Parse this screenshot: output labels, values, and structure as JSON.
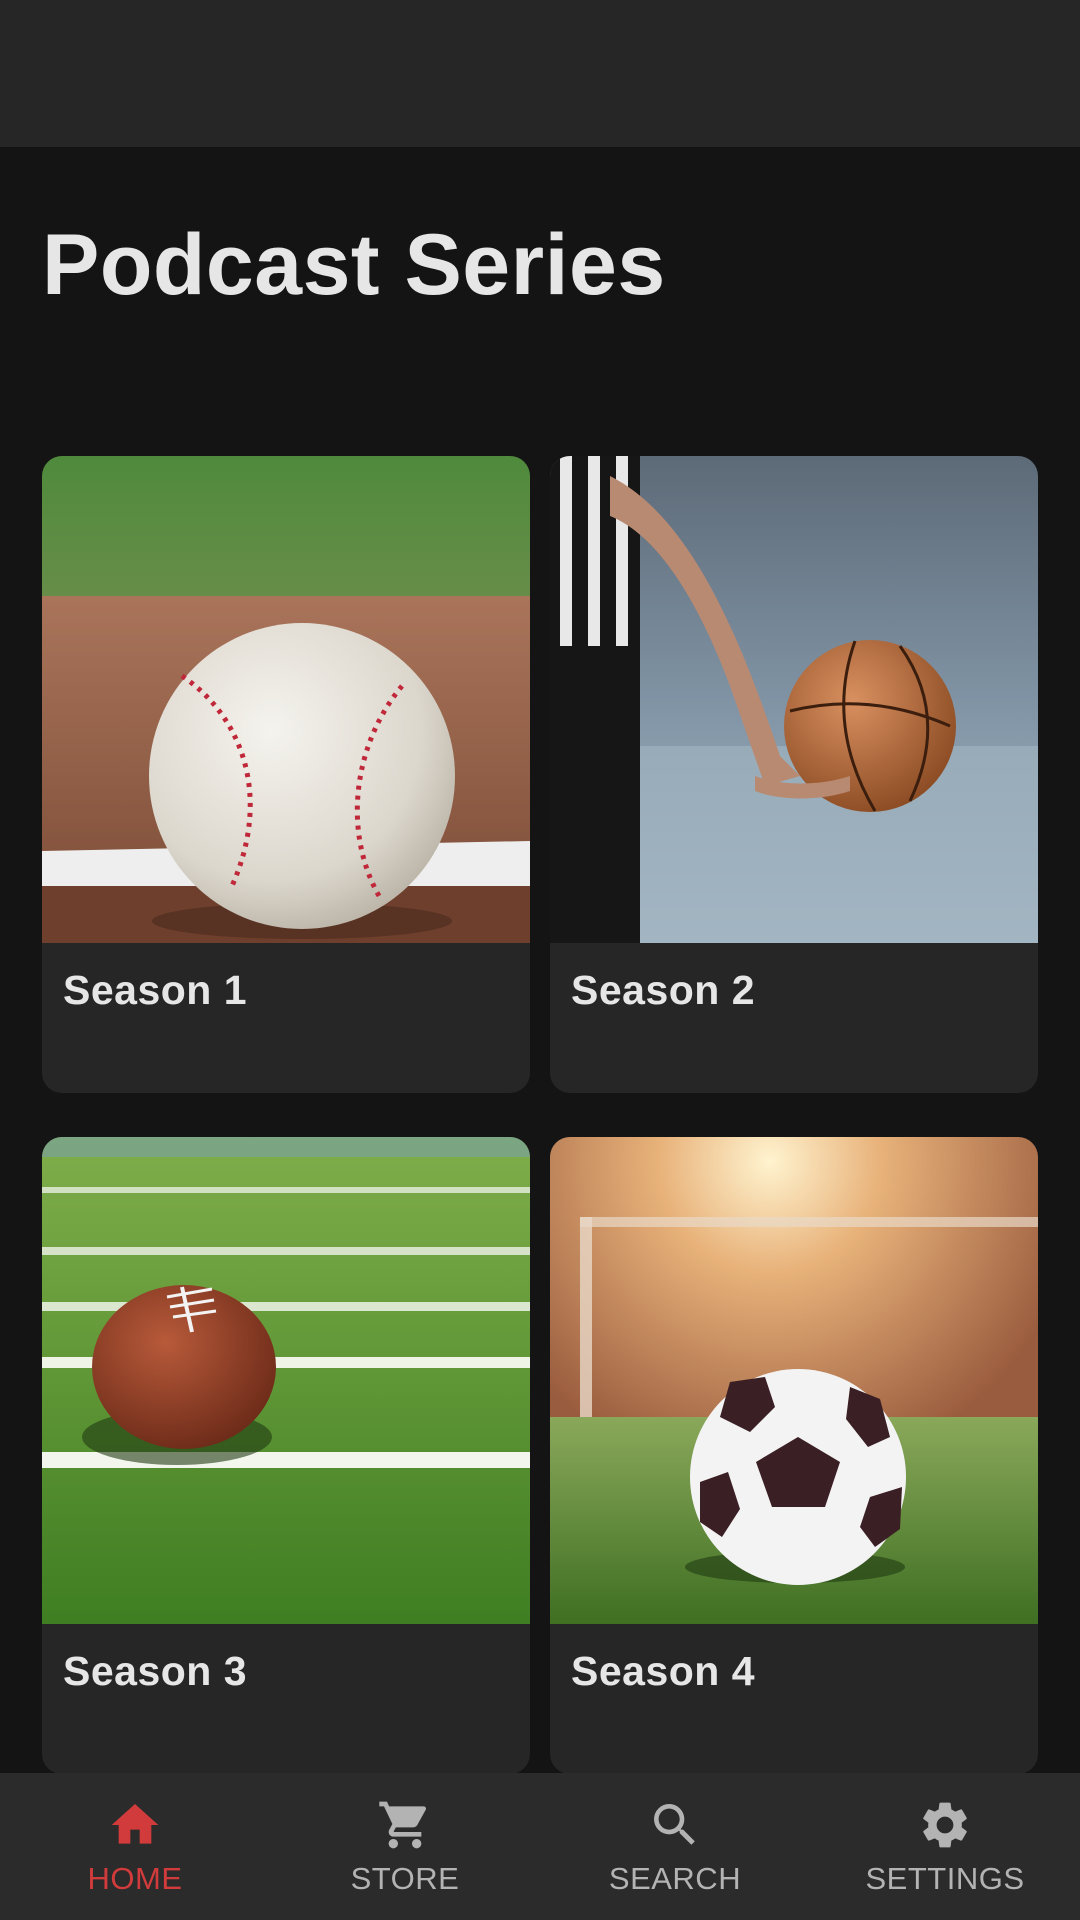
{
  "app": {
    "title": "Podcast Series"
  },
  "seasons": [
    {
      "label": "Season 1",
      "image": "baseball-image"
    },
    {
      "label": "Season 2",
      "image": "basketball-image"
    },
    {
      "label": "Season 3",
      "image": "american-football-image"
    },
    {
      "label": "Season 4",
      "image": "soccer-ball-image"
    }
  ],
  "nav": {
    "items": [
      {
        "label": "HOME",
        "icon": "home-icon",
        "active": true
      },
      {
        "label": "STORE",
        "icon": "cart-icon",
        "active": false
      },
      {
        "label": "SEARCH",
        "icon": "search-icon",
        "active": false
      },
      {
        "label": "SETTINGS",
        "icon": "gear-icon",
        "active": false
      }
    ]
  },
  "colors": {
    "background": "#141414",
    "surface": "#262626",
    "accent": "#d13b3b",
    "text": "#e6e6e6",
    "nav_inactive": "#b3b3b3"
  }
}
